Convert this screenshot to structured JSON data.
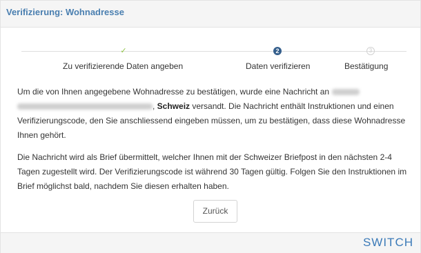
{
  "header": {
    "title": "Verifizierung: Wohnadresse"
  },
  "steps": [
    {
      "label": "Zu verifizierende Daten angeben",
      "icon": "check-icon",
      "glyph": "✓",
      "state": "done"
    },
    {
      "label": "Daten verifizieren",
      "icon": "step-2-icon",
      "glyph": "2",
      "state": "active"
    },
    {
      "label": "Bestätigung",
      "icon": "step-3-icon",
      "glyph": "3",
      "state": "pending"
    }
  ],
  "body": {
    "p1_part1": "Um die von Ihnen angegebene Wohnadresse zu bestätigen, wurde eine Nachricht an",
    "p1_country": "Schweiz",
    "p1_part2": " versandt. Die Nachricht enthält Instruktionen und einen Verifizierungscode, den Sie anschliessend eingeben müssen, um zu bestätigen, dass diese Wohnadresse Ihnen gehört.",
    "p2": "Die Nachricht wird als Brief übermittelt, welcher Ihnen mit der Schweizer Briefpost in den nächsten 2-4 Tagen zugestellt wird. Der Verifizierungscode ist während 30 Tagen gültig. Folgen Sie den Instruktionen im Brief möglichst bald, nachdem Sie diesen erhalten haben."
  },
  "buttons": {
    "back_label": "Zurück"
  },
  "footer": {
    "brand": "SWITCH"
  },
  "colors": {
    "title": "#4a7fb0",
    "done": "#8ec243",
    "active": "#355f8c",
    "brand": "#3b7ab8"
  }
}
